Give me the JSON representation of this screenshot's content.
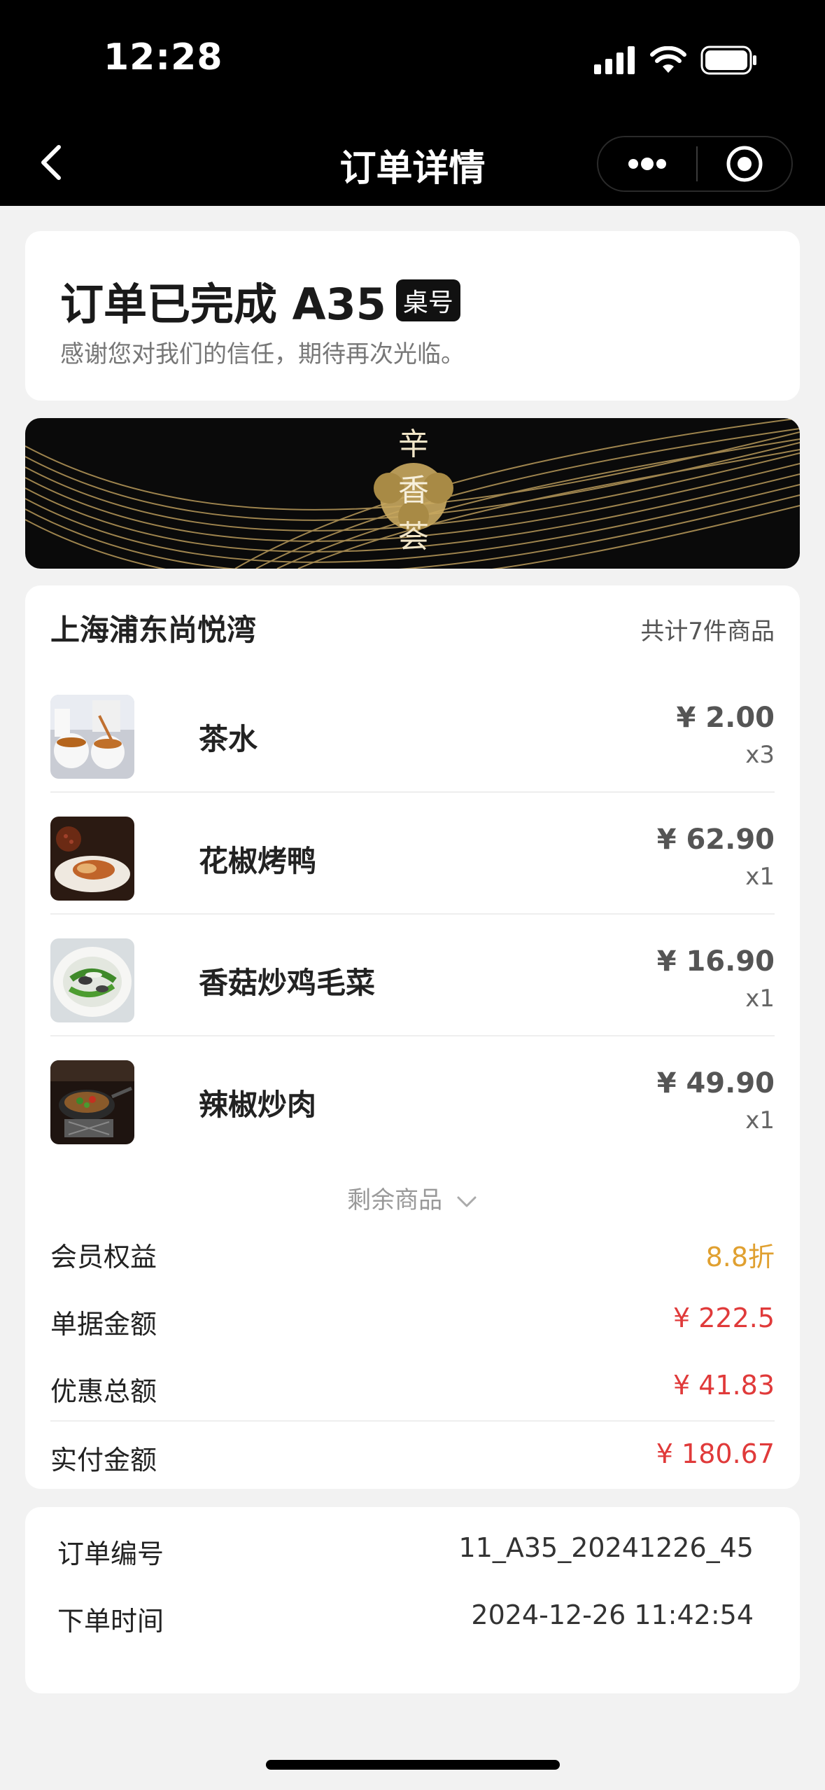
{
  "status_bar": {
    "time": "12:28"
  },
  "nav": {
    "title": "订单详情"
  },
  "status_card": {
    "title": "订单已完成 A35",
    "badge": "桌号",
    "subtitle": "感谢您对我们的信任，期待再次光临。"
  },
  "order": {
    "store": "上海浦东尚悦湾",
    "count_label": "共计7件商品",
    "items": [
      {
        "name": "茶水",
        "price": "¥ 2.00",
        "qty": "x3"
      },
      {
        "name": "花椒烤鸭",
        "price": "¥ 62.90",
        "qty": "x1"
      },
      {
        "name": "香菇炒鸡毛菜",
        "price": "¥ 16.90",
        "qty": "x1"
      },
      {
        "name": "辣椒炒肉",
        "price": "¥ 49.90",
        "qty": "x1"
      }
    ],
    "more_label": "剩余商品",
    "summary": [
      {
        "label": "会员权益",
        "value": "8.8折",
        "color": "#e0a030"
      },
      {
        "label": "单据金额",
        "value": "¥ 222.5",
        "color": "#e03a3a"
      },
      {
        "label": "优惠总额",
        "value": "¥ 41.83",
        "color": "#e03a3a"
      },
      {
        "label": "实付金额",
        "value": "¥ 180.67",
        "color": "#e03a3a"
      }
    ]
  },
  "info": {
    "order_no_label": "订单编号",
    "order_no": "11_A35_20241226_45",
    "time_label": "下单时间",
    "time": "2024-12-26 11:42:54"
  },
  "logo_text": [
    "辛",
    "香",
    "荟"
  ]
}
